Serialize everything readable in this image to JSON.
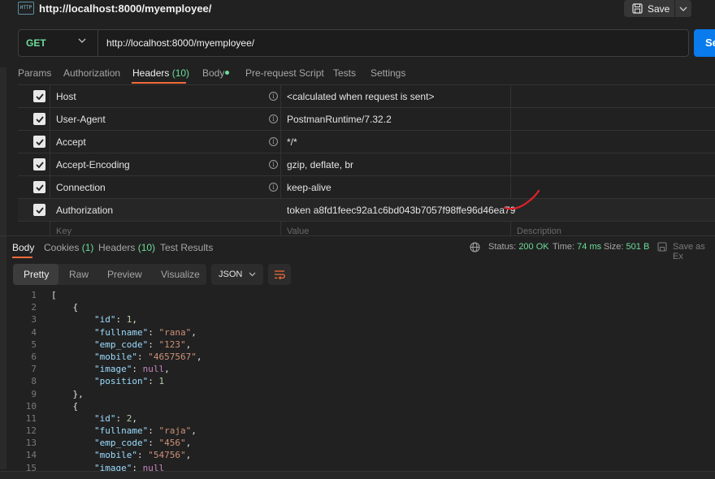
{
  "window": {
    "title": "http://localhost:8000/myemployee/",
    "icon": "http-icon"
  },
  "toolbar": {
    "save_label": "Save"
  },
  "request": {
    "method": "GET",
    "url": "http://localhost:8000/myemployee/",
    "send_label": "Se"
  },
  "request_tabs": {
    "params": "Params",
    "authorization": "Authorization",
    "headers": "Headers",
    "headers_count": "(10)",
    "body": "Body",
    "pre_request": "Pre-request Script",
    "tests": "Tests",
    "settings": "Settings"
  },
  "headers": [
    {
      "key": "Host",
      "value": "<calculated when request is sent>",
      "checked": true
    },
    {
      "key": "User-Agent",
      "value": "PostmanRuntime/7.32.2",
      "checked": true
    },
    {
      "key": "Accept",
      "value": "*/*",
      "checked": true
    },
    {
      "key": "Accept-Encoding",
      "value": "gzip, deflate, br",
      "checked": true
    },
    {
      "key": "Connection",
      "value": "keep-alive",
      "checked": true
    },
    {
      "key": "Authorization",
      "value": "token a8fd1feec92a1c6bd043b7057f98ffe96d46ea79",
      "checked": true
    }
  ],
  "header_placeholders": {
    "key": "Key",
    "value": "Value",
    "description": "Description"
  },
  "response_tabs": {
    "body": "Body",
    "cookies": "Cookies",
    "cookies_count": "(1)",
    "headers": "Headers",
    "headers_count": "(10)",
    "test_results": "Test Results"
  },
  "status": {
    "status_label": "Status:",
    "status_value": "200 OK",
    "time_label": "Time:",
    "time_value": "74 ms",
    "size_label": "Size:",
    "size_value": "501 B",
    "save_as": "Save as Ex"
  },
  "view_modes": {
    "pretty": "Pretty",
    "raw": "Raw",
    "preview": "Preview",
    "visualize": "Visualize",
    "format": "JSON"
  },
  "code_lines": [
    {
      "n": "1",
      "t": "["
    },
    {
      "n": "2",
      "t": "    {"
    },
    {
      "n": "3",
      "t": "        \"id\": 1,"
    },
    {
      "n": "4",
      "t": "        \"fullname\": \"rana\","
    },
    {
      "n": "5",
      "t": "        \"emp_code\": \"123\","
    },
    {
      "n": "6",
      "t": "        \"mobile\": \"4657567\","
    },
    {
      "n": "7",
      "t": "        \"image\": null,"
    },
    {
      "n": "8",
      "t": "        \"position\": 1"
    },
    {
      "n": "9",
      "t": "    },"
    },
    {
      "n": "10",
      "t": "    {"
    },
    {
      "n": "11",
      "t": "        \"id\": 2,"
    },
    {
      "n": "12",
      "t": "        \"fullname\": \"raja\","
    },
    {
      "n": "13",
      "t": "        \"emp_code\": \"456\","
    },
    {
      "n": "14",
      "t": "        \"mobile\": \"54756\","
    },
    {
      "n": "15",
      "t": "        \"image\": null"
    }
  ],
  "colors": {
    "accent": "#f26b3a",
    "green": "#6bdd9a",
    "send": "#097bed",
    "annotation": "#e0202a"
  }
}
